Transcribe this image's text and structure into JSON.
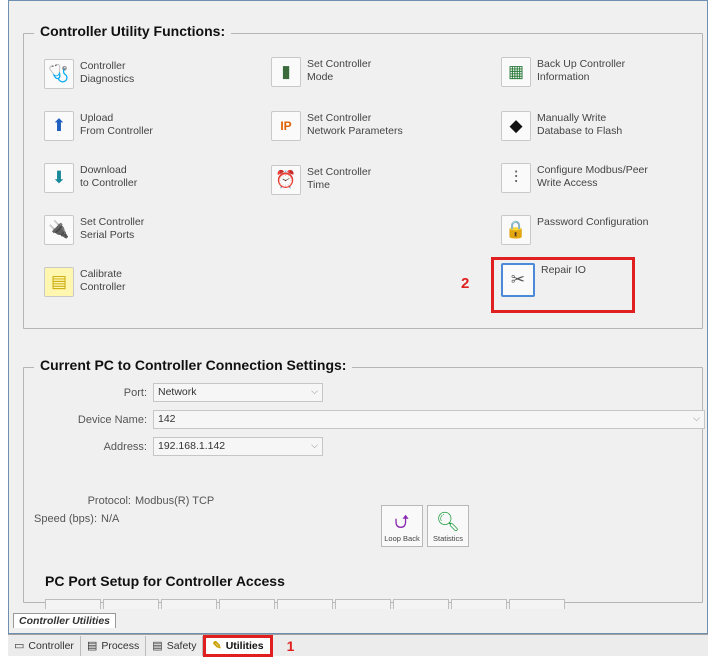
{
  "utilities": {
    "title": "Controller Utility Functions:",
    "items": [
      {
        "icon": "🩺",
        "line1": "Controller",
        "line2": "Diagnostics"
      },
      {
        "icon": "⬆",
        "line1": "Upload",
        "line2": "From Controller"
      },
      {
        "icon": "⬇",
        "line1": "Download",
        "line2": "to Controller"
      },
      {
        "icon": "🔌",
        "line1": "Set Controller",
        "line2": "Serial Ports"
      },
      {
        "icon": "▤",
        "line1": "Calibrate",
        "line2": "Controller"
      },
      {
        "icon": "▮",
        "line1": "Set Controller",
        "line2": "Mode"
      },
      {
        "icon": "IP",
        "line1": "Set  Controller",
        "line2": "Network Parameters"
      },
      {
        "icon": "⏰",
        "line1": "Set Controller",
        "line2": "Time"
      },
      {
        "icon": "▦",
        "line1": "Back Up Controller",
        "line2": "Information"
      },
      {
        "icon": "◆",
        "line1": "Manually Write",
        "line2": "Database to Flash"
      },
      {
        "icon": "⫶",
        "line1": "Configure Modbus/Peer",
        "line2": "Write Access"
      },
      {
        "icon": "🔒",
        "line1": "Password Configuration",
        "line2": ""
      },
      {
        "icon": "✂",
        "line1": "Repair IO",
        "line2": ""
      }
    ]
  },
  "annotations": {
    "num1": "1",
    "num2": "2"
  },
  "connection": {
    "title": "Current PC to Controller Connection Settings:",
    "port_label": "Port:",
    "port_value": "Network",
    "device_label": "Device Name:",
    "device_value": "142",
    "address_label": "Address:",
    "address_value": "192.168.1.142",
    "protocol_label": "Protocol:",
    "protocol_value": "Modbus(R) TCP",
    "speed_label": "Speed (bps):",
    "speed_value": "N/A",
    "loopback_label": "Loop Back",
    "statistics_label": "Statistics",
    "port_setup_title": "PC Port Setup for Controller Access"
  },
  "inner_tab": "Controller Utilities",
  "status_tabs": [
    {
      "icon": "▭",
      "label": "Controller"
    },
    {
      "icon": "▤",
      "label": "Process"
    },
    {
      "icon": "▤",
      "label": "Safety"
    },
    {
      "icon": "✎",
      "label": "Utilities"
    }
  ],
  "colors": {
    "annotation": "#e02020",
    "selected_border": "#4a8ad8"
  }
}
